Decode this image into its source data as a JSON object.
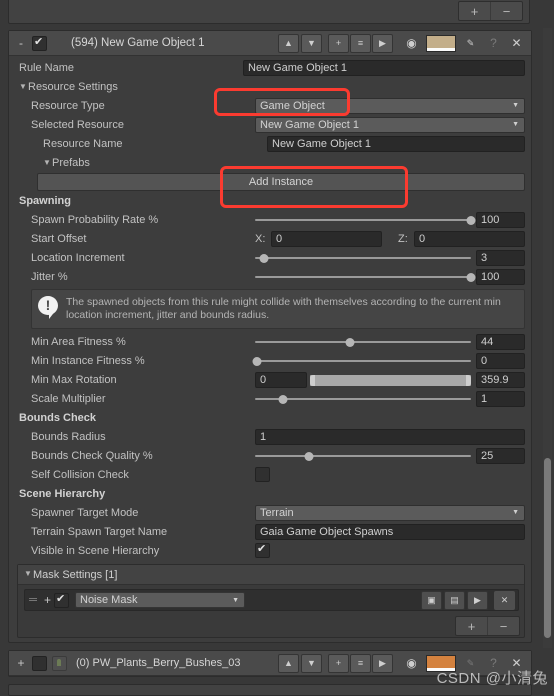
{
  "top_strip": {
    "plus_label": "+",
    "minus_label": "−"
  },
  "rule_header": {
    "collapse_label": "-",
    "enabled": true,
    "title": "(594) New Game Object 1",
    "tools": {
      "move_up": "▲",
      "move_down": "▼",
      "add": "+",
      "duplicate": "≡",
      "run": "▶",
      "visibility": "◉",
      "color_swatch": "#c3ae8a",
      "eyedropper": "✎",
      "help": "?",
      "close": "✕"
    }
  },
  "fields": {
    "rule_name": {
      "label": "Rule Name",
      "value": "New Game Object 1"
    },
    "resource_settings": {
      "label": "Resource Settings",
      "expanded": true
    },
    "resource_type": {
      "label": "Resource Type",
      "value": "Game Object"
    },
    "selected_resource": {
      "label": "Selected Resource",
      "value": "New Game Object 1"
    },
    "resource_name": {
      "label": "Resource Name",
      "value": "New Game Object 1"
    },
    "prefabs": {
      "label": "Prefabs",
      "expanded": true
    },
    "add_instance": {
      "label": "Add Instance"
    },
    "spawning_header": {
      "label": "Spawning"
    },
    "spawn_probability": {
      "label": "Spawn Probability Rate %",
      "value": "100",
      "percent": 100
    },
    "start_offset": {
      "label": "Start Offset",
      "x_label": "X:",
      "x_value": "0",
      "z_label": "Z:",
      "z_value": "0"
    },
    "location_increment": {
      "label": "Location Increment",
      "value": "3",
      "percent": 4
    },
    "jitter": {
      "label": "Jitter %",
      "value": "100",
      "percent": 100
    },
    "warning": {
      "text": "The spawned objects from this rule might collide with themselves according to the current min location increment, jitter and bounds radius."
    },
    "min_area_fitness": {
      "label": "Min Area Fitness %",
      "value": "44",
      "percent": 44
    },
    "min_instance_fitness": {
      "label": "Min Instance Fitness %",
      "value": "0",
      "percent": 1
    },
    "min_max_rotation": {
      "label": "Min Max Rotation",
      "min_value": "0",
      "max_value": "359.9"
    },
    "scale_multiplier": {
      "label": "Scale Multiplier",
      "value": "1",
      "percent": 13
    },
    "bounds_check_header": {
      "label": "Bounds Check"
    },
    "bounds_radius": {
      "label": "Bounds Radius",
      "value": "1"
    },
    "bounds_check_quality": {
      "label": "Bounds Check Quality %",
      "value": "25",
      "percent": 25
    },
    "self_collision_check": {
      "label": "Self Collision Check",
      "checked": false
    },
    "scene_hierarchy_header": {
      "label": "Scene Hierarchy"
    },
    "spawner_target_mode": {
      "label": "Spawner Target Mode",
      "value": "Terrain"
    },
    "terrain_spawn_target_name": {
      "label": "Terrain Spawn Target Name",
      "value": "Gaia Game Object Spawns"
    },
    "visible_in_scene_hierarchy": {
      "label": "Visible in Scene Hierarchy",
      "checked": true
    }
  },
  "mask_settings": {
    "header": "Mask Settings [1]",
    "expanded": true,
    "rows": [
      {
        "drag": "═",
        "plus": "+",
        "enabled": true,
        "type": "Noise Mask",
        "tools": {
          "add": "▣",
          "duplicate": "▤",
          "run": "▶",
          "close": "✕"
        }
      }
    ],
    "footer": {
      "plus_label": "+",
      "minus_label": "−"
    }
  },
  "bottom_rule": {
    "plus_label": "+",
    "enabled": false,
    "title": "(0) PW_Plants_Berry_Bushes_03",
    "tools": {
      "move_up": "▲",
      "move_down": "▼",
      "add": "+",
      "duplicate": "≡",
      "run": "▶",
      "visibility": "◉",
      "color_swatch": "#d4823f",
      "eyedropper": "✎",
      "help": "?",
      "close": "✕"
    }
  },
  "watermark": {
    "text": "CSDN @小清兔"
  },
  "annotations": {
    "color": "#fb3b30"
  }
}
